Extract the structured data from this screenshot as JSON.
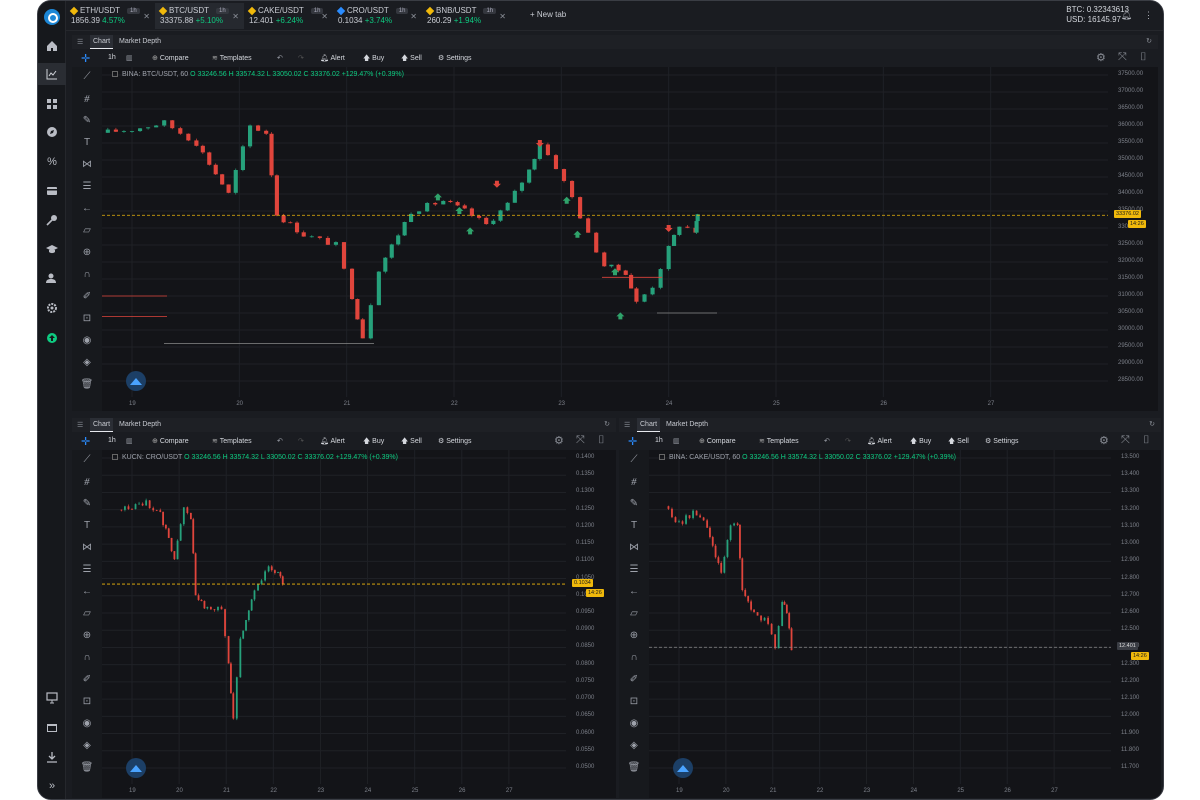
{
  "sidebar": {
    "items": [
      {
        "name": "home-icon"
      },
      {
        "name": "chart-icon"
      },
      {
        "name": "grid-icon"
      },
      {
        "name": "compass-icon"
      },
      {
        "name": "percent-icon"
      },
      {
        "name": "wallet-icon"
      },
      {
        "name": "key-icon"
      },
      {
        "name": "graduation-icon"
      },
      {
        "name": "user-icon"
      },
      {
        "name": "settings-icon"
      },
      {
        "name": "upgrade-icon"
      },
      {
        "name": "monitor-icon"
      },
      {
        "name": "window-icon"
      },
      {
        "name": "download-icon"
      },
      {
        "name": "expand-icon"
      }
    ]
  },
  "tabs": [
    {
      "symbol": "ETH/USDT",
      "tf": "1h",
      "price": "1856.39",
      "change": "4.57%"
    },
    {
      "symbol": "BTC/USDT",
      "tf": "1h",
      "price": "33375.88",
      "change": "+5.10%"
    },
    {
      "symbol": "CAKE/USDT",
      "tf": "1h",
      "price": "12.401",
      "change": "+6.24%"
    },
    {
      "symbol": "CRO/USDT",
      "tf": "1h",
      "price": "0.1034",
      "change": "+3.74%"
    },
    {
      "symbol": "BNB/USDT",
      "tf": "1h",
      "price": "260.29",
      "change": "+1.94%"
    }
  ],
  "newtab": "New tab",
  "balance": {
    "btc": "BTC: 0.32343613",
    "usd": "USD: 16145.97"
  },
  "toolbar": {
    "chart": "Chart",
    "depth": "Market Depth",
    "interval": "1h",
    "compare": "Compare",
    "templates": "Templates",
    "alert": "Alert",
    "buy": "Buy",
    "sell": "Sell",
    "settings": "Settings"
  },
  "charts": {
    "main": {
      "symbol": "BINA: BTC/USDT, 60",
      "o": "O 33246.56",
      "h": "H 33574.32",
      "l": "L 33050.02",
      "c": "C 33376.02",
      "chg": "+129.47% (+0.39%)",
      "price_ticks": [
        "37500.00",
        "37000.00",
        "36500.00",
        "36000.00",
        "35500.00",
        "35000.00",
        "34500.00",
        "34000.00",
        "33500.00",
        "33000.00",
        "32500.00",
        "32000.00",
        "31500.00",
        "31000.00",
        "30500.00",
        "30000.00",
        "29500.00",
        "29000.00",
        "28500.00"
      ],
      "last_price": "33376.02",
      "timer": "14:26",
      "x_ticks": [
        "19",
        "20",
        "21",
        "22",
        "23",
        "24",
        "25",
        "26",
        "27"
      ]
    },
    "cro": {
      "symbol": "KUCN: CRO/USDT",
      "o": "O 33246.56",
      "h": "H 33574.32",
      "l": "L 33050.02",
      "c": "C 33376.02",
      "chg": "+129.47% (+0.39%)",
      "price_ticks": [
        "0.1400",
        "0.1350",
        "0.1300",
        "0.1250",
        "0.1200",
        "0.1150",
        "0.1100",
        "0.1050",
        "0.1000",
        "0.0950",
        "0.0900",
        "0.0850",
        "0.0800",
        "0.0750",
        "0.0700",
        "0.0650",
        "0.0600",
        "0.0550",
        "0.0500"
      ],
      "last_price": "0.1034",
      "timer": "14:26",
      "x_ticks": [
        "19",
        "20",
        "21",
        "22",
        "23",
        "24",
        "25",
        "26",
        "27"
      ]
    },
    "cake": {
      "symbol": "BINA: CAKE/USDT, 60",
      "o": "O 33246.56",
      "h": "H 33574.32",
      "l": "L 33050.02",
      "c": "C 33376.02",
      "chg": "+129.47% (+0.39%)",
      "price_ticks": [
        "13.500",
        "13.400",
        "13.300",
        "13.200",
        "13.100",
        "13.000",
        "12.900",
        "12.800",
        "12.700",
        "12.600",
        "12.500",
        "12.400",
        "12.300",
        "12.200",
        "12.100",
        "12.000",
        "11.900",
        "11.800",
        "11.700"
      ],
      "last_price": "12.401",
      "timer": "14:26",
      "x_ticks": [
        "19",
        "20",
        "21",
        "22",
        "23",
        "24",
        "25",
        "26",
        "27"
      ]
    }
  },
  "colors": {
    "up": "#26a17b",
    "down": "#e0453c",
    "accent": "#f0b90b"
  }
}
